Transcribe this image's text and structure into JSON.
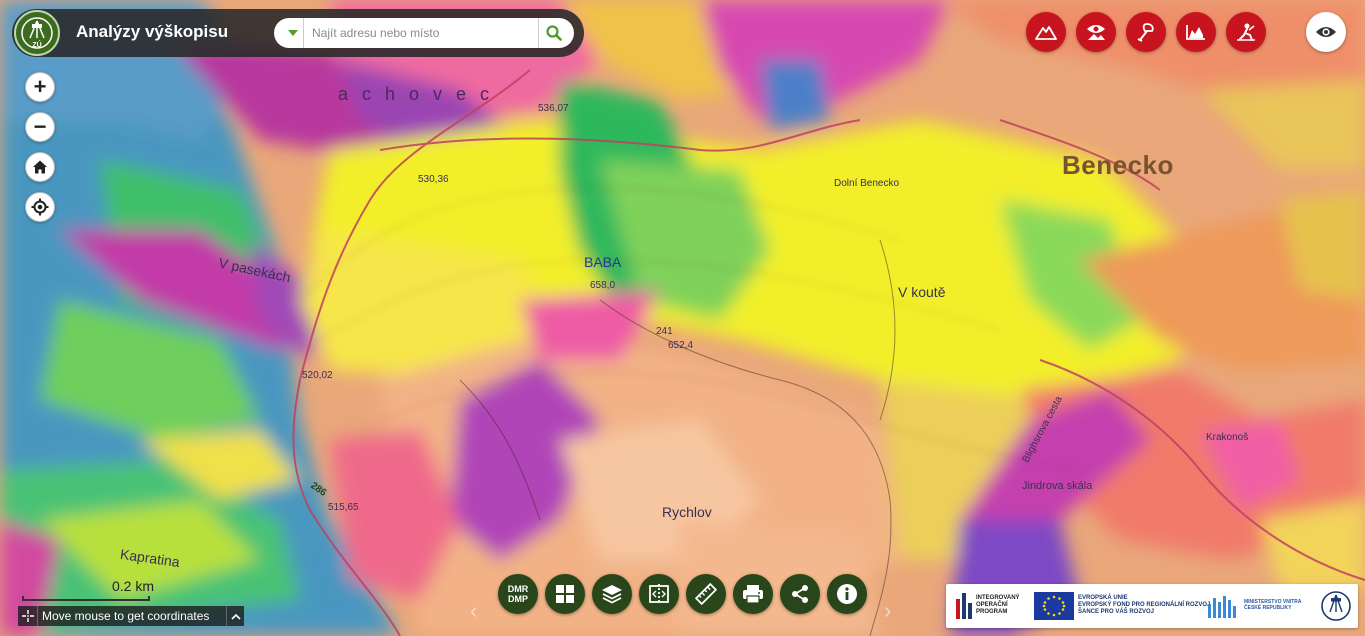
{
  "header": {
    "app_title": "Analýzy výškopisu",
    "logo_text": "ZÚ"
  },
  "search": {
    "placeholder": "Najít adresu nebo místo"
  },
  "map_controls": {
    "zoom_in": "+",
    "zoom_out": "−"
  },
  "map_labels": {
    "benecko": "Benecko",
    "achovec": "achovec",
    "v_pasekach": "V pasekách",
    "baba": "BABA",
    "v_koute": "V koutě",
    "rychlov": "Rychlov",
    "kapratina": "Kapratina",
    "dolni_benecko": "Dolní Benecko",
    "jindrova_skala": "Jindrova skála",
    "krakonos": "Krakonoš",
    "blighsrova_cesta": "Blighsrova cesta",
    "road_286": "286",
    "elev_536": "536,07",
    "elev_530": "530,36",
    "elev_658": "658,0",
    "elev_652": "652,4",
    "elev_520": "520,02",
    "elev_515": "515,65",
    "elev_241": "241"
  },
  "bottom_toolbar": {
    "dmr_line1": "DMR",
    "dmr_line2": "DMP"
  },
  "scale": {
    "label": "0.2 km"
  },
  "coordinates": {
    "text": "Move mouse to get coordinates"
  },
  "funding": {
    "iop_line1": "INTEGROVANÝ",
    "iop_line2": "OPERAČNÍ",
    "iop_line3": "PROGRAM",
    "eu_line1": "EVROPSKÁ UNIE",
    "eu_line2": "EVROPSKÝ FOND PRO REGIONÁLNÍ ROZVOJ",
    "eu_line3": "ŠANCE PRO VÁŠ ROZVOJ",
    "mv_line1": "MINISTERSTVO VNITRA",
    "mv_line2": "ČESKÉ REPUBLIKY"
  },
  "colors": {
    "tool_red": "#c8141e",
    "toolbar_green": "#28461a",
    "header_dark": "#282828"
  },
  "icons": {
    "tools": [
      "mountain-icon",
      "eye-landscape-icon",
      "shovel-icon",
      "terrain-profile-icon",
      "excavation-icon"
    ],
    "toolbar": [
      "dmr-dmp-toggle",
      "grid-icon",
      "layers-icon",
      "compare-icon",
      "ruler-icon",
      "print-icon",
      "share-icon",
      "info-icon"
    ]
  }
}
